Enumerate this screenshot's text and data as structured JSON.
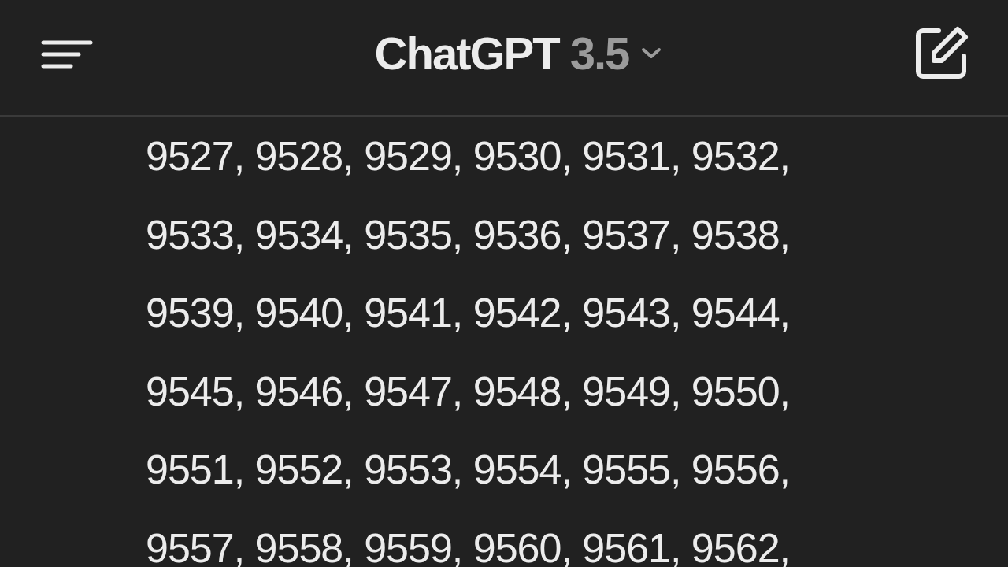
{
  "header": {
    "title": "ChatGPT",
    "version": "3.5"
  },
  "message": {
    "lines": [
      "9527, 9528, 9529, 9530, 9531, 9532,",
      "9533, 9534, 9535, 9536, 9537, 9538,",
      "9539, 9540, 9541, 9542, 9543, 9544,",
      "9545, 9546, 9547, 9548, 9549, 9550,",
      "9551, 9552, 9553, 9554, 9555, 9556,",
      "9557, 9558, 9559, 9560, 9561, 9562,"
    ]
  }
}
